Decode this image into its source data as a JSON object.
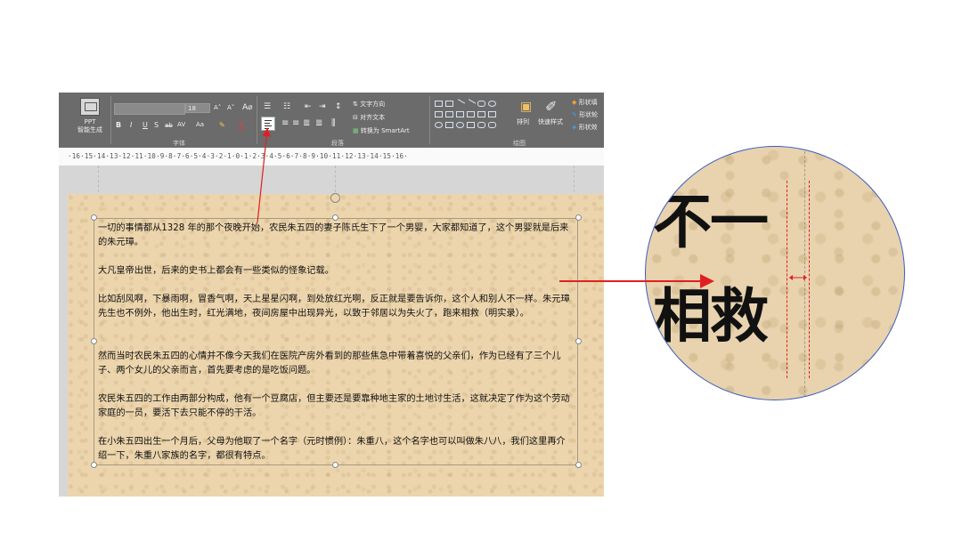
{
  "ribbon": {
    "ppt_button": {
      "line1": "PPT",
      "line2": "智能生成"
    },
    "font_name": "",
    "font_size": "18",
    "font_group_label": "字体",
    "paragraph_group_label": "段落",
    "drawing_group_label": "绘图",
    "text_direction": "文字方向",
    "align_text": "对齐文本",
    "convert_smartart": "转换为 SmartArt",
    "arrange": "排列",
    "quick_styles": "快速样式",
    "shape_fill": "形状填",
    "shape_outline": "形状轮",
    "shape_effects": "形状效"
  },
  "ruler": {
    "text": "·16·15·14·13·12·11·10·9·8·7·6·5·4·3·2·1·0·1·2·3·4·5·6·7·8·9·10·11·12·13·14·15·16·"
  },
  "paragraphs": [
    "一切的事情都从1328 年的那个夜晚开始，农民朱五四的妻子陈氏生下了一个男婴，大家都知道了，这个男婴就是后来的朱元璋。",
    "大凡皇帝出世，后来的史书上都会有一些类似的怪象记载。",
    "比如刮风啊，下暴雨啊，冒香气啊，天上星星闪啊，到处放红光啊，反正就是要告诉你，这个人和别人不一样。朱元璋先生也不例外，他出生时，红光满地，夜间房屋中出现异光，以致于邻居以为失火了，跑来相救（明实录）。",
    "然而当时农民朱五四的心情并不像今天我们在医院产房外看到的那些焦急中带着喜悦的父亲们，作为已经有了三个儿子、两个女儿的父亲而言，首先要考虑的是吃饭问题。",
    "农民朱五四的工作由两部分构成，他有一个豆腐店，但主要还是要靠种地主家的土地讨生活，这就决定了作为这个劳动家庭的一员，要活下去只能不停的干活。",
    "在小朱五四出生一个月后，父母为他取了一个名字（元时惯例）：朱重八，这个名字也可以叫做朱八八，我们这里再介绍一下，朱重八家族的名字，都很有特点。"
  ],
  "magnifier": {
    "line1": "不一",
    "line2": "相救"
  },
  "colors": {
    "annotation_red": "#e02020",
    "magnifier_border": "#3a5cc0",
    "ribbon_bg": "#6b6b6b",
    "parchment": "#ecd5ad"
  },
  "icons": {
    "align_left": "align-left-icon",
    "rotate": "rotate-handle-icon"
  }
}
